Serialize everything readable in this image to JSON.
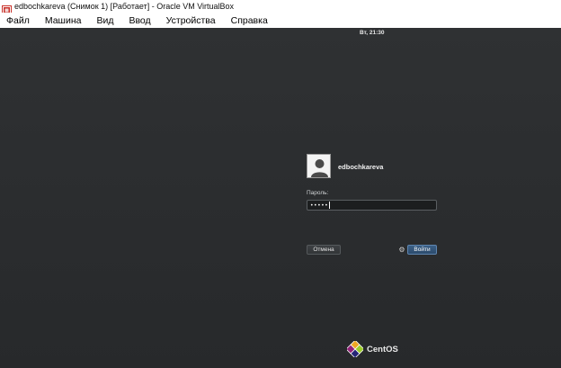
{
  "window": {
    "title": "edbochkareva (Снимок 1) [Работает] - Oracle VM VirtualBox"
  },
  "menubar": {
    "items": [
      {
        "label": "Файл"
      },
      {
        "label": "Машина"
      },
      {
        "label": "Вид"
      },
      {
        "label": "Ввод"
      },
      {
        "label": "Устройства"
      },
      {
        "label": "Справка"
      }
    ]
  },
  "topbar": {
    "clock": "Вт, 21:30"
  },
  "login": {
    "username": "edbochkareva",
    "password_label": "Пароль:",
    "password_value": "•••••",
    "cancel_label": "Отмена",
    "login_label": "Войти"
  },
  "branding": {
    "logo_text": "CentOS"
  },
  "colors": {
    "screen_bg": "#2b2d2f",
    "accent_blue": "#3b5f86"
  },
  "icons": {
    "app": "virtualbox-icon",
    "avatar": "user-avatar-icon",
    "settings": "gear-icon",
    "brand": "centos-logo-icon"
  }
}
